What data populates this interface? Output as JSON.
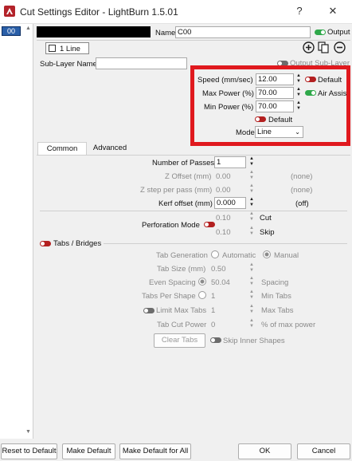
{
  "window": {
    "title": "Cut Settings Editor - LightBurn 1.5.01",
    "help_glyph": "?",
    "close_glyph": "✕"
  },
  "layer_list": {
    "selected": "00"
  },
  "header": {
    "name_label": "Name",
    "name_value": "C00",
    "output_label": "Output",
    "sub_layer_count": "1 Line",
    "sub_layer_name_label": "Sub-Layer Name",
    "sub_layer_name_value": "",
    "output_sub_layer_label": "Output Sub-Layer"
  },
  "highlight": {
    "speed_label": "Speed (mm/sec)",
    "speed_value": "12.00",
    "default_label_1": "Default",
    "max_power_label": "Max Power (%)",
    "max_power_value": "70.00",
    "air_assist_label": "Air Assist",
    "min_power_label": "Min Power (%)",
    "min_power_value": "70.00",
    "default_label_2": "Default",
    "mode_label": "Mode",
    "mode_value": "Line"
  },
  "tabs": [
    {
      "label": "Common"
    },
    {
      "label": "Advanced"
    }
  ],
  "common": {
    "passes_label": "Number of Passes",
    "passes_value": "1",
    "z_offset_label": "Z Offset (mm)",
    "z_offset_value": "0.00",
    "z_offset_note": "(none)",
    "z_step_label": "Z step per pass (mm)",
    "z_step_value": "0.00",
    "z_step_note": "(none)",
    "kerf_label": "Kerf offset (mm)",
    "kerf_value": "0.000",
    "kerf_note": "(off)",
    "perforation_label": "Perforation Mode",
    "cut_value": "0.10",
    "cut_label": "Cut",
    "skip_value": "0.10",
    "skip_label": "Skip"
  },
  "tabs_section": {
    "header": "Tabs / Bridges",
    "tab_generation_label": "Tab Generation",
    "automatic_label": "Automatic",
    "manual_label": "Manual",
    "tab_size_label": "Tab Size (mm)",
    "tab_size_value": "0.50",
    "even_spacing_label": "Even Spacing",
    "spacing_value": "50.04",
    "spacing_label": "Spacing",
    "tabs_per_shape_label": "Tabs Per Shape",
    "tabs_per_shape_value": "1",
    "min_tabs_label": "Min Tabs",
    "limit_max_tabs_label": "Limit Max Tabs",
    "max_tabs_value": "1",
    "max_tabs_label": "Max Tabs",
    "tab_cut_power_label": "Tab Cut Power",
    "tab_cut_power_value": "0",
    "pct_label": "% of max power",
    "clear_tabs_label": "Clear Tabs",
    "skip_inner_label": "Skip Inner Shapes"
  },
  "footer": {
    "reset_label": "Reset to Default",
    "make_default_label": "Make Default",
    "make_default_all_label": "Make Default for All",
    "ok_label": "OK",
    "cancel_label": "Cancel"
  },
  "colors": {
    "highlight_border": "#e0191e",
    "toggle_on": "#2fa84a",
    "toggle_off_red": "#b32020",
    "layer_selected": "#2a5fa8"
  }
}
